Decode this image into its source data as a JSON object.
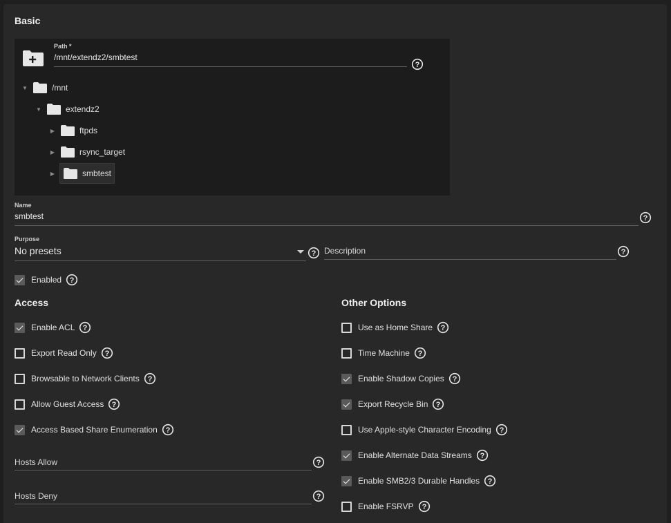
{
  "basic": {
    "title": "Basic"
  },
  "path": {
    "label": "Path *",
    "value": "/mnt/extendz2/smbtest"
  },
  "tree": {
    "root": "/mnt",
    "child": "extendz2",
    "items": [
      "ftpds",
      "rsync_target",
      "smbtest"
    ]
  },
  "name": {
    "label": "Name",
    "value": "smbtest"
  },
  "purpose": {
    "label": "Purpose",
    "value": "No presets"
  },
  "description": {
    "placeholder": "Description"
  },
  "enabled": {
    "label": "Enabled",
    "checked": true
  },
  "access": {
    "title": "Access",
    "options": [
      {
        "label": "Enable ACL",
        "checked": true
      },
      {
        "label": "Export Read Only",
        "checked": false
      },
      {
        "label": "Browsable to Network Clients",
        "checked": false
      },
      {
        "label": "Allow Guest Access",
        "checked": false
      },
      {
        "label": "Access Based Share Enumeration",
        "checked": true
      }
    ],
    "hosts_allow": "Hosts Allow",
    "hosts_deny": "Hosts Deny"
  },
  "other": {
    "title": "Other Options",
    "options": [
      {
        "label": "Use as Home Share",
        "checked": false
      },
      {
        "label": "Time Machine",
        "checked": false
      },
      {
        "label": "Enable Shadow Copies",
        "checked": true
      },
      {
        "label": "Export Recycle Bin",
        "checked": true
      },
      {
        "label": "Use Apple-style Character Encoding",
        "checked": false
      },
      {
        "label": "Enable Alternate Data Streams",
        "checked": true
      },
      {
        "label": "Enable SMB2/3 Durable Handles",
        "checked": true
      },
      {
        "label": "Enable FSRVP",
        "checked": false
      }
    ]
  }
}
